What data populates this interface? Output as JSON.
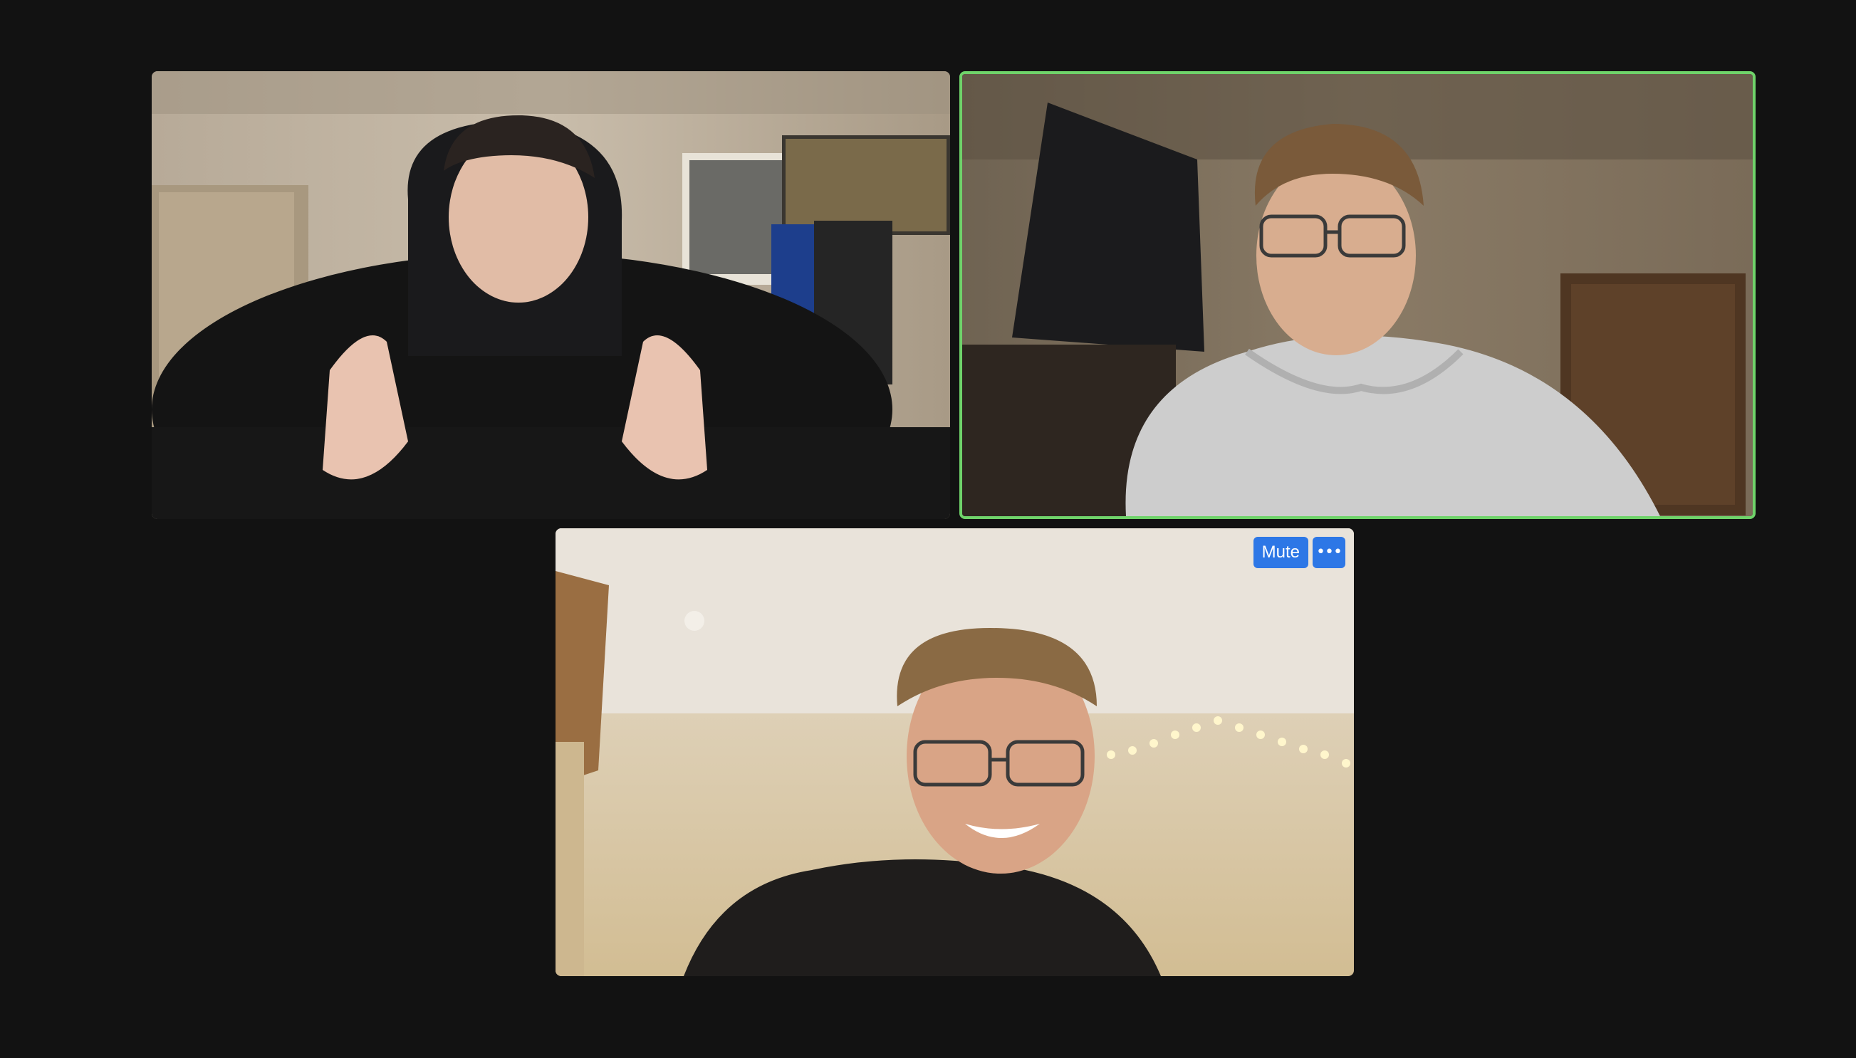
{
  "meeting": {
    "background_color": "#121212",
    "active_speaker_border_color": "#6fd36a"
  },
  "participants": [
    {
      "video_icon": "participant-video-1",
      "active_speaker": false
    },
    {
      "video_icon": "participant-video-2",
      "active_speaker": true
    },
    {
      "video_icon": "participant-video-3",
      "active_speaker": false,
      "controls": {
        "mute_label": "Mute",
        "more_label": "•••",
        "accent_color": "#2d77e6"
      }
    }
  ]
}
